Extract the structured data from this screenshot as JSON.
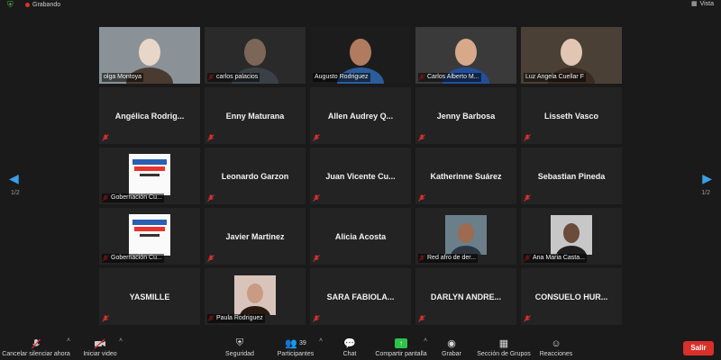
{
  "topbar": {
    "recording_label": "Grabando",
    "view_label": "Vista"
  },
  "pagination": {
    "left": "1/2",
    "right": "1/2"
  },
  "participants": [
    {
      "name": "olga Montoya",
      "style": "video",
      "mic": false,
      "active": false
    },
    {
      "name": "carlos palacios",
      "style": "video",
      "mic": true,
      "active": false
    },
    {
      "name": "Augusto Rodriguez",
      "style": "video",
      "mic": false,
      "active": false
    },
    {
      "name": "Carlos Alberto M...",
      "style": "video",
      "mic": true,
      "active": false
    },
    {
      "name": "Luz Angela Cuellar F",
      "style": "video",
      "mic": false,
      "active": true
    },
    {
      "name": "Angélica Rodrig...",
      "style": "text",
      "mic": true
    },
    {
      "name": "Enny Maturana",
      "style": "text",
      "mic": true
    },
    {
      "name": "Allen Audrey Q...",
      "style": "text",
      "mic": true
    },
    {
      "name": "Jenny Barbosa",
      "style": "text",
      "mic": true
    },
    {
      "name": "Lisseth Vasco",
      "style": "text",
      "mic": true
    },
    {
      "name": "Gobernación Cu...",
      "style": "logo",
      "mic": true
    },
    {
      "name": "Leonardo Garzon",
      "style": "text",
      "mic": true
    },
    {
      "name": "Juan Vicente Cu...",
      "style": "text",
      "mic": true
    },
    {
      "name": "Katherinne Suárez",
      "style": "text",
      "mic": true
    },
    {
      "name": "Sebastian Pineda",
      "style": "text",
      "mic": true
    },
    {
      "name": "Gobernación Cu...",
      "style": "logo",
      "mic": true
    },
    {
      "name": "Javier Martinez",
      "style": "text",
      "mic": true
    },
    {
      "name": "Alicia Acosta",
      "style": "text",
      "mic": true
    },
    {
      "name": "Red afro de der...",
      "style": "photo",
      "mic": true
    },
    {
      "name": "Ana Maria Casta...",
      "style": "photo",
      "mic": true
    },
    {
      "name": "YASMILLE",
      "style": "text",
      "mic": true
    },
    {
      "name": "Paula Rodriguez",
      "style": "photo",
      "mic": true
    },
    {
      "name": "SARA FABIOLA...",
      "style": "text",
      "mic": true
    },
    {
      "name": "DARLYN ANDRE...",
      "style": "text",
      "mic": true
    },
    {
      "name": "CONSUELO HUR...",
      "style": "text",
      "mic": true
    }
  ],
  "toolbar": {
    "unmute_label": "Cancelar silenciar ahora",
    "start_video_label": "Iniciar video",
    "security_label": "Seguridad",
    "participants_label": "Participantes",
    "participants_count": "39",
    "chat_label": "Chat",
    "share_label": "Compartir pantalla",
    "record_label": "Grabar",
    "breakout_label": "Sección de Grupos",
    "reactions_label": "Reacciones",
    "leave_label": "Salir"
  },
  "colors": {
    "accent_share": "#2ec14b",
    "leave": "#d9302a",
    "active_outline": "#d8e04a",
    "nav_arrow": "#3a9ee8"
  }
}
